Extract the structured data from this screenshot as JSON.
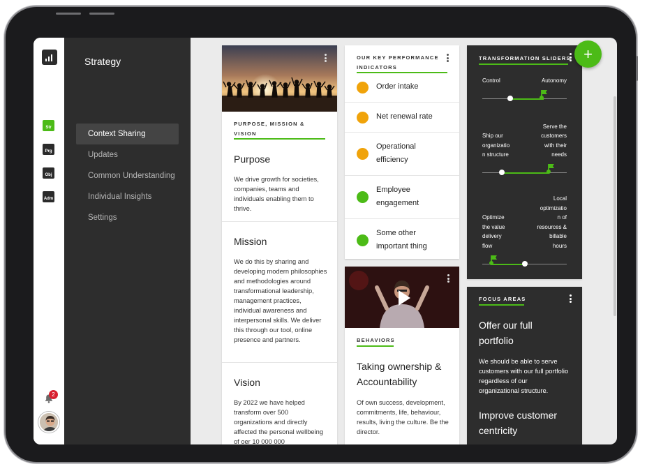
{
  "rail": {
    "items": [
      {
        "code": "Str",
        "active": true
      },
      {
        "code": "Prg",
        "active": false
      },
      {
        "code": "Obj",
        "active": false
      },
      {
        "code": "Adm",
        "active": false
      }
    ],
    "notifications": "2"
  },
  "nav": {
    "title": "Strategy",
    "items": [
      "Context Sharing",
      "Updates",
      "Common Understanding",
      "Individual Insights",
      "Settings"
    ]
  },
  "purpose_card": {
    "label": "PURPOSE, MISSION & VISION",
    "sections": [
      {
        "title": "Purpose",
        "text": "We drive growth for societies, companies, teams and individuals enabling them to thrive."
      },
      {
        "title": "Mission",
        "text": "We do this by sharing and developing modern philosophies and methodologies around transformational leadership, management practices, individual awareness and interpersonal skills. We deliver this through our tool, online presence and partners."
      },
      {
        "title": "Vision",
        "text": "By 2022 we have helped transform over 500 organizations and directly affected the personal wellbeing of oer 10 000 000"
      }
    ]
  },
  "kpi_card": {
    "label": "OUR KEY PERFORMANCE INDICATORS",
    "items": [
      {
        "line1": "Order intake",
        "line2": "",
        "status_color": "#f0a30a"
      },
      {
        "line1": "Net renewal rate",
        "line2": "",
        "status_color": "#f0a30a"
      },
      {
        "line1": "Operational",
        "line2": "efficiency",
        "status_color": "#f0a30a"
      },
      {
        "line1": "Employee",
        "line2": "engagement",
        "status_color": "#4cbb17"
      },
      {
        "line1": "Some other",
        "line2": "important thing",
        "status_color": "#4cbb17"
      }
    ]
  },
  "behaviors_card": {
    "label": "BEHAVIORS",
    "title_line1": "Taking ownership &",
    "title_line2": "Accountability",
    "text": "Of own success, development, commitments, life, behaviour, results, living the culture. Be the director."
  },
  "sliders_card": {
    "label": "TRANSFORMATION SLIDERS",
    "sliders": [
      {
        "left": [
          "Control"
        ],
        "right": [
          "Autonomy"
        ],
        "current": 0.33,
        "target": 0.72
      },
      {
        "left": [
          "Ship our",
          "organizatio",
          "n structure"
        ],
        "right": [
          "Serve the",
          "customers",
          "with their",
          "needs"
        ],
        "current": 0.23,
        "target": 0.8
      },
      {
        "left": [
          "Optimize",
          "the value",
          "delivery",
          "flow"
        ],
        "right": [
          "Local",
          "optimizatio",
          "n of",
          "resources &",
          "billable",
          "hours"
        ],
        "current": 0.52,
        "target": 0.11
      }
    ]
  },
  "focus_card": {
    "label": "FOCUS AREAS",
    "areas": [
      {
        "title_line1": "Offer our full",
        "title_line2": "portfolio",
        "text": "We should be able to serve customers with our full portfolio regardless of our organizational structure."
      },
      {
        "title_line1": "Improve customer",
        "title_line2": "centricity",
        "text": ""
      }
    ]
  },
  "fab": {
    "label": "+"
  },
  "colors": {
    "accent": "#4cbb17",
    "warning": "#f0a30a",
    "dark_panel": "#2d2d2d"
  }
}
